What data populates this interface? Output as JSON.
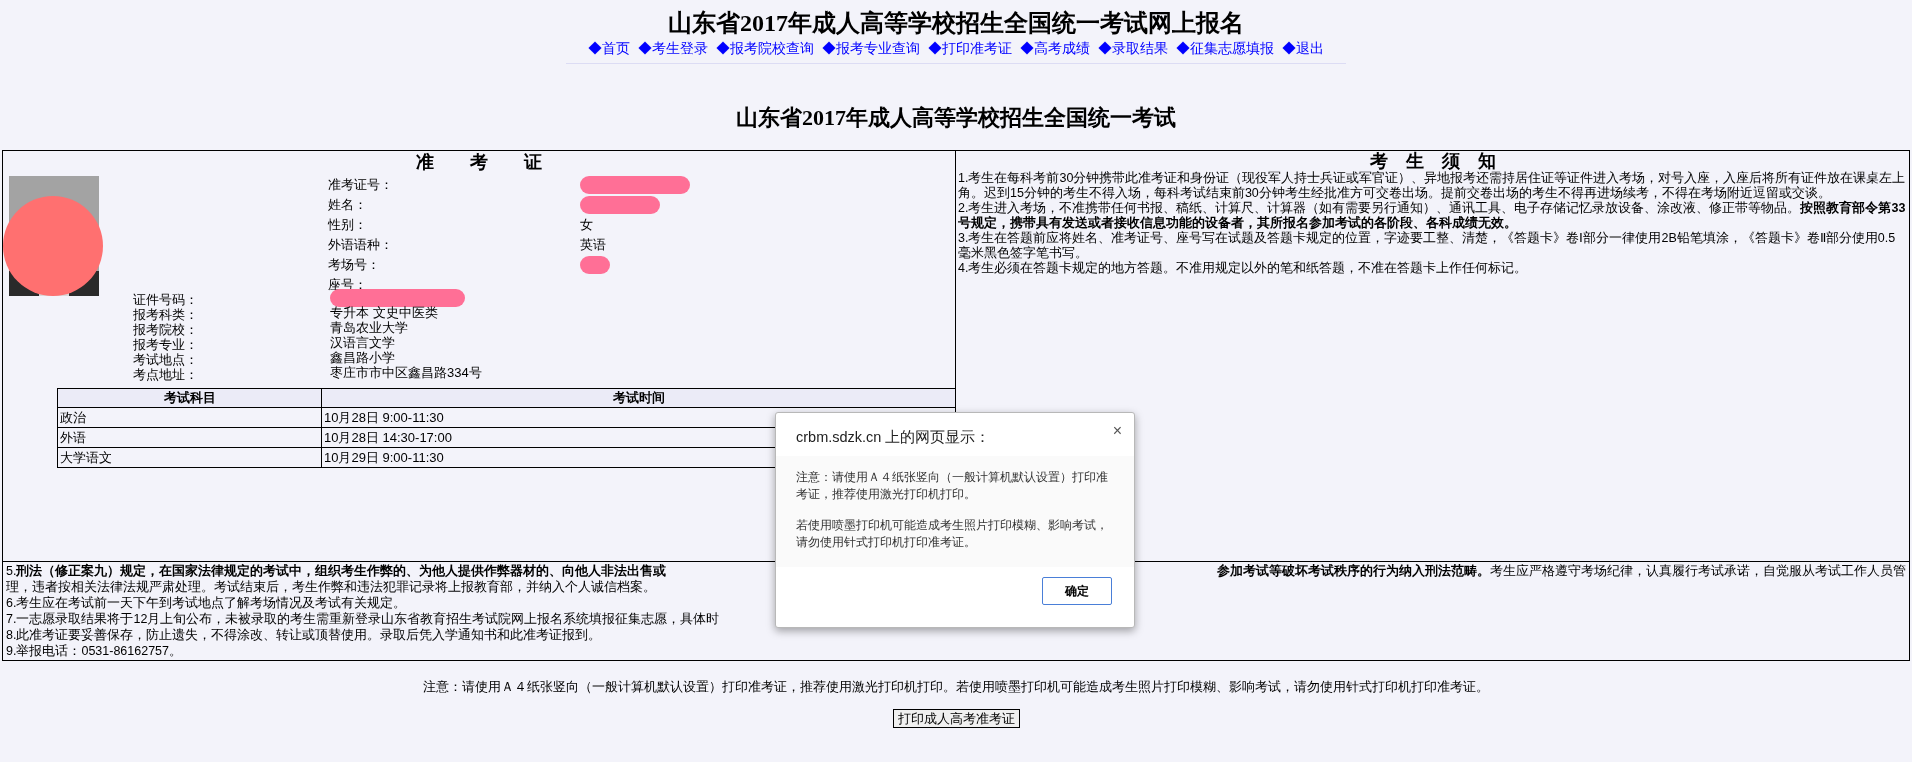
{
  "header": {
    "title": "山东省2017年成人高等学校招生全国统一考试网上报名",
    "nav": [
      "◆首页",
      "◆考生登录",
      "◆报考院校查询",
      "◆报考专业查询",
      "◆打印准考证",
      "◆高考成绩",
      "◆录取结果",
      "◆征集志愿填报",
      "◆退出"
    ]
  },
  "page_title": "山东省2017年成人高等学校招生全国统一考试",
  "ticket": {
    "title": "准　　考　　证",
    "photo": {
      "redacted": true
    },
    "top_fields": [
      {
        "label": "准考证号：",
        "redacted": true
      },
      {
        "label": "姓名：",
        "redacted": true
      },
      {
        "label": "性别：",
        "value": "女"
      },
      {
        "label": "外语语种：",
        "value": "英语"
      },
      {
        "label": "考场号：",
        "redacted": true
      },
      {
        "label": "座号："
      }
    ],
    "fields": [
      {
        "label": "证件号码：",
        "redacted": true
      },
      {
        "label": "报考科类：",
        "value": "专升本  文史中医类"
      },
      {
        "label": "报考院校：",
        "value": "青岛农业大学"
      },
      {
        "label": "报考专业：",
        "value": "汉语言文学"
      },
      {
        "label": "考试地点：",
        "value": "鑫昌路小学"
      },
      {
        "label": "考点地址：",
        "value": "枣庄市市中区鑫昌路334号"
      }
    ],
    "exam_table": {
      "columns": [
        "考试科目",
        "考试时间"
      ],
      "rows": [
        [
          "政治",
          "10月28日 9:00-11:30"
        ],
        [
          "外语",
          "10月28日 14:30-17:00"
        ],
        [
          "大学语文",
          "10月29日 9:00-11:30"
        ]
      ]
    }
  },
  "notice": {
    "title": "考　生　须　知",
    "items": [
      "1.考生在每科考前30分钟携带此准考证和身份证（现役军人持士兵证或军官证）、异地报考还需持居住证等证件进入考场，对号入座，入座后将所有证件放在课桌左上角。迟到15分钟的考生不得入场，每科考试结束前30分钟考生经批准方可交卷出场。提前交卷出场的考生不得再进场续考，不得在考场附近逗留或交谈。",
      "2.考生进入考场，不准携带任何书报、稿纸、计算尺、计算器（如有需要另行通知）、通讯工具、电子存储记忆录放设备、涂改液、修正带等物品。**按照教育部令第33号规定，携带具有发送或者接收信息功能的设备者，其所报名参加考试的各阶段、各科成绩无效。**",
      "3.考生在答题前应将姓名、准考证号、座号写在试题及答题卡规定的位置，字迹要工整、清楚，《答题卡》卷Ⅰ部分一律使用2B铅笔填涂，《答题卡》卷Ⅱ部分使用0.5毫米黑色签字笔书写。",
      "4.考生必须在答题卡规定的地方答题。不准用规定以外的笔和纸答题，不准在答题卡上作任何标记。"
    ]
  },
  "lower_notice": [
    {
      "left": "5.**刑法（修正案九）规定，在国家法律规定的考试中，组织考生作弊的、为他人提供作弊器材的、向他人非法出售或**",
      "right": "**参加考试等破坏考试秩序的行为纳入刑法范畴。**考生应严格遵守考场纪律，认真履行考试承诺，自觉服从考试工作人员管"
    },
    {
      "left": "理，违者按相关法律法规严肃处理。考试结束后，考生作弊和违法犯罪记录将上报教育部，并纳入个人诚信档案。"
    },
    {
      "left": "6.考生应在考试前一天下午到考试地点了解考场情况及考试有关规定。"
    },
    {
      "left": "7.一志愿录取结果将于12月上旬公布，未被录取的考生需重新登录山东省教育招生考试院网上报名系统填报征集志愿，具体时"
    },
    {
      "left": "8.此准考证要妥善保存，防止遗失，不得涂改、转让或顶替使用。录取后凭入学通知书和此准考证报到。"
    },
    {
      "left": "9.举报电话：0531-86162757。"
    }
  ],
  "footer_note": "注意：请使用Ａ４纸张竖向（一般计算机默认设置）打印准考证，推荐使用激光打印机打印。若使用喷墨打印机可能造成考生照片打印模糊、影响考试，请勿使用针式打印机打印准考证。",
  "print_button": "打印成人高考准考证",
  "dialog": {
    "title": "crbm.sdzk.cn 上的网页显示：",
    "close": "×",
    "paragraphs": [
      "注意：请使用Ａ４纸张竖向（一般计算机默认设置）打印准考证，推荐使用激光打印机打印。",
      "若使用喷墨打印机可能造成考生照片打印模糊、影响考试，请勿使用针式打印机打印准考证。"
    ],
    "button": "确定"
  }
}
